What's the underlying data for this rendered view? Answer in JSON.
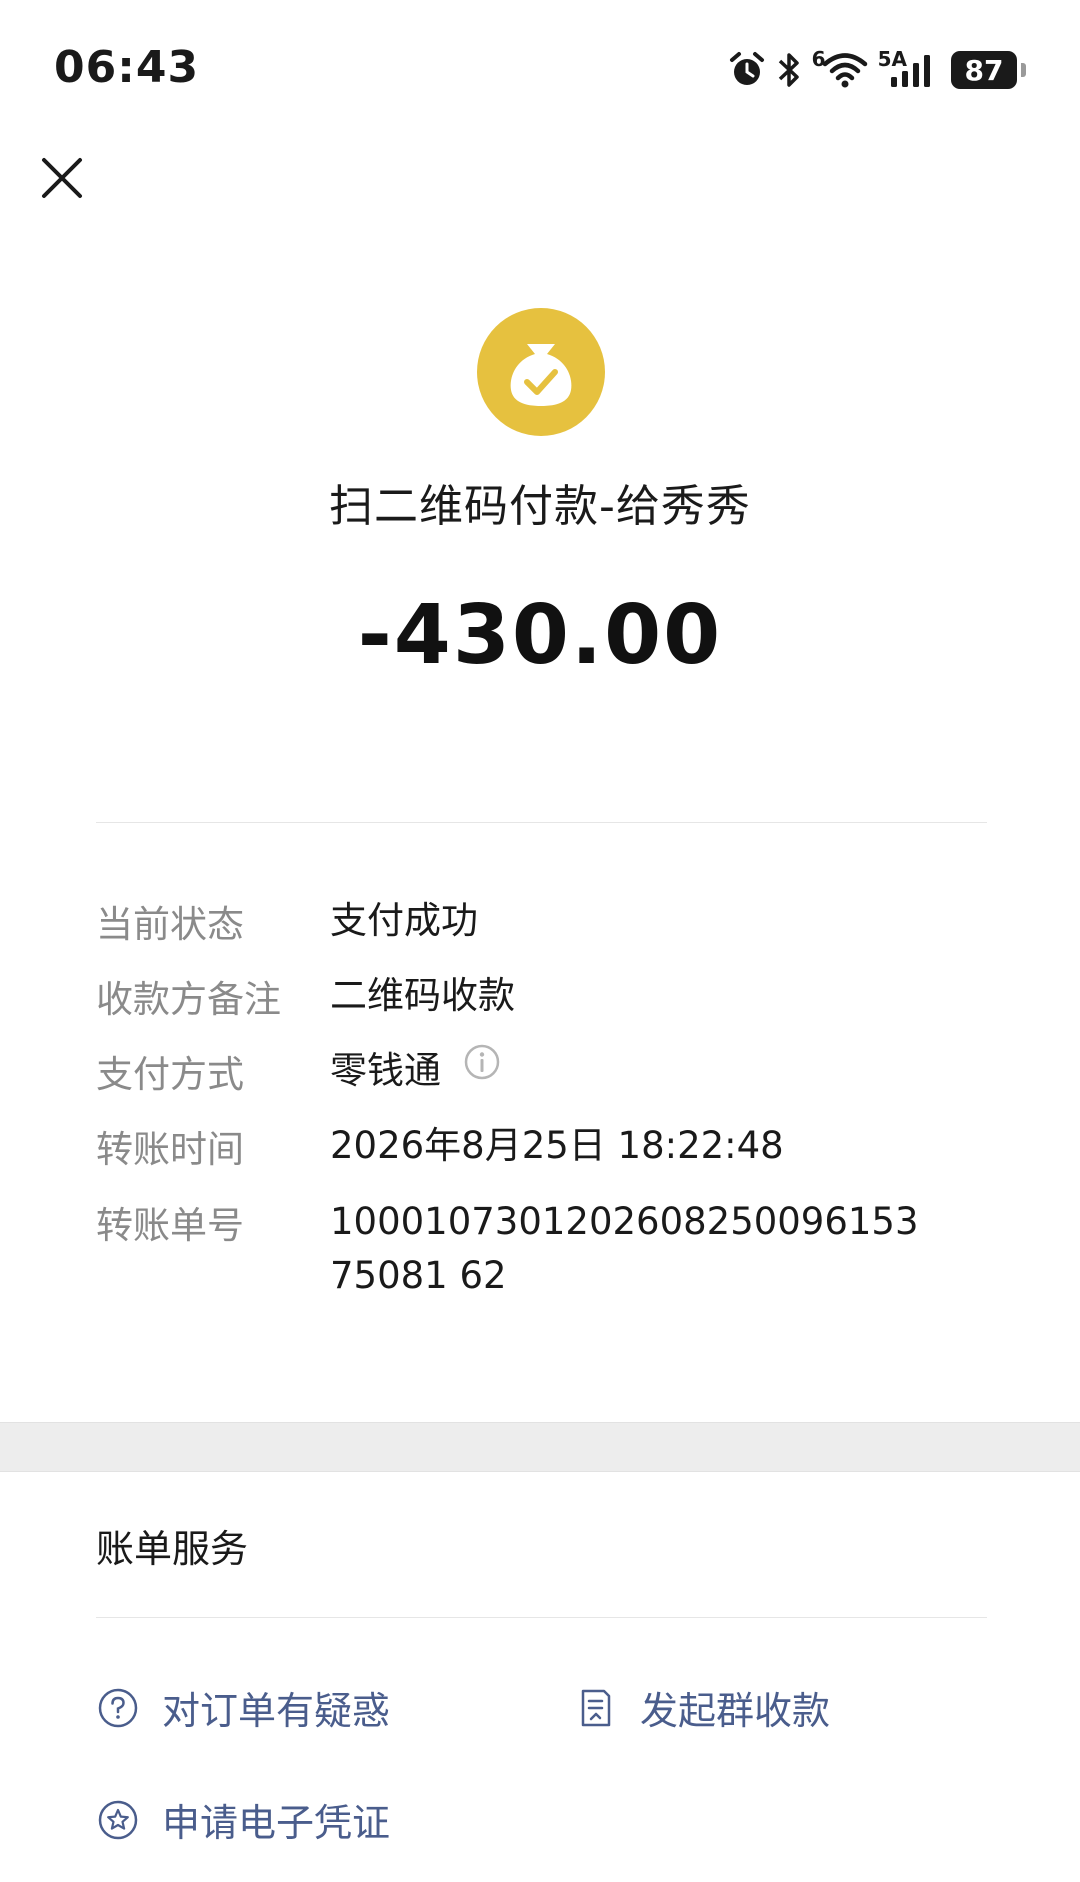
{
  "status_bar": {
    "time": "06:43",
    "wifi_label": "6",
    "signal_label": "5A",
    "battery": "87"
  },
  "header": {
    "icon": "money-bag-check-icon",
    "title": "扫二维码付款-给秀秀",
    "amount": "-430.00",
    "accent_color": "#e6c13f"
  },
  "details": [
    {
      "label": "当前状态",
      "value": "支付成功"
    },
    {
      "label": "收款方备注",
      "value": "二维码收款"
    },
    {
      "label": "支付方式",
      "value": "零钱通"
    },
    {
      "label": "转账时间",
      "value": "2026年8月25日 18:22:48"
    },
    {
      "label": "转账单号",
      "value": "100010730120260825009615375081 62"
    }
  ],
  "services": {
    "title": "账单服务",
    "items": [
      {
        "label": "对订单有疑惑",
        "icon": "question-circle-icon"
      },
      {
        "label": "发起群收款",
        "icon": "document-pen-icon"
      },
      {
        "label": "申请电子凭证",
        "icon": "star-badge-icon"
      }
    ],
    "link_color": "#4a5d8c"
  }
}
